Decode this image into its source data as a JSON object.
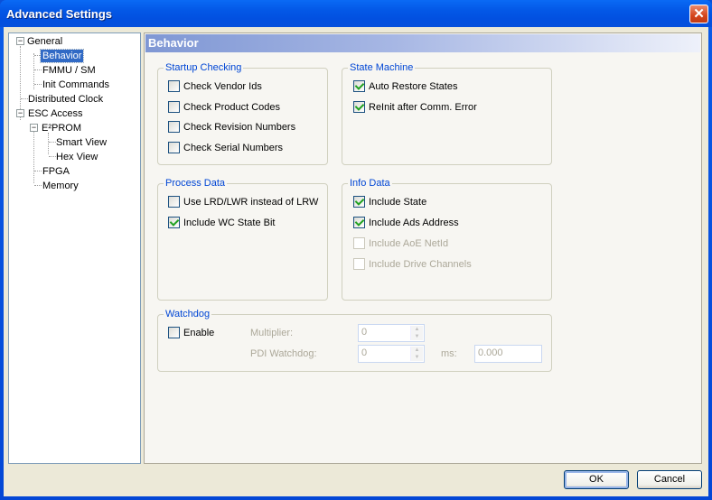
{
  "window": {
    "title": "Advanced Settings",
    "close_label": "✕"
  },
  "tree": {
    "items": [
      {
        "label": "General",
        "expander": "−"
      },
      {
        "label": "Behavior",
        "selected": true
      },
      {
        "label": "FMMU / SM"
      },
      {
        "label": "Init Commands"
      },
      {
        "label": "Distributed Clock"
      },
      {
        "label": "ESC Access",
        "expander": "−"
      },
      {
        "label": "E²PROM",
        "expander": "−"
      },
      {
        "label": "Smart View"
      },
      {
        "label": "Hex View"
      },
      {
        "label": "FPGA"
      },
      {
        "label": "Memory"
      }
    ]
  },
  "panel": {
    "title": "Behavior",
    "startup": {
      "title": "Startup Checking",
      "items": [
        {
          "label": "Check Vendor Ids",
          "checked": false
        },
        {
          "label": "Check Product Codes",
          "checked": false
        },
        {
          "label": "Check Revision Numbers",
          "checked": false
        },
        {
          "label": "Check Serial Numbers",
          "checked": false
        }
      ]
    },
    "state_machine": {
      "title": "State Machine",
      "items": [
        {
          "label": "Auto Restore States",
          "checked": true
        },
        {
          "label": "ReInit after Comm. Error",
          "checked": true
        }
      ]
    },
    "process_data": {
      "title": "Process Data",
      "items": [
        {
          "label": "Use LRD/LWR instead of LRW",
          "checked": false
        },
        {
          "label": "Include WC State Bit",
          "checked": true
        }
      ]
    },
    "info_data": {
      "title": "Info Data",
      "items": [
        {
          "label": "Include State",
          "checked": true
        },
        {
          "label": "Include Ads Address",
          "checked": true
        },
        {
          "label": "Include AoE NetId",
          "checked": false,
          "disabled": true
        },
        {
          "label": "Include Drive Channels",
          "checked": false,
          "disabled": true
        }
      ]
    },
    "watchdog": {
      "title": "Watchdog",
      "enable_label": "Enable",
      "enable_checked": false,
      "multiplier_label": "Multiplier:",
      "multiplier_value": "0",
      "pdi_label": "PDI Watchdog:",
      "pdi_value": "0",
      "ms_label": "ms:",
      "ms_value": "0.000"
    }
  },
  "buttons": {
    "ok": "OK",
    "cancel": "Cancel"
  }
}
